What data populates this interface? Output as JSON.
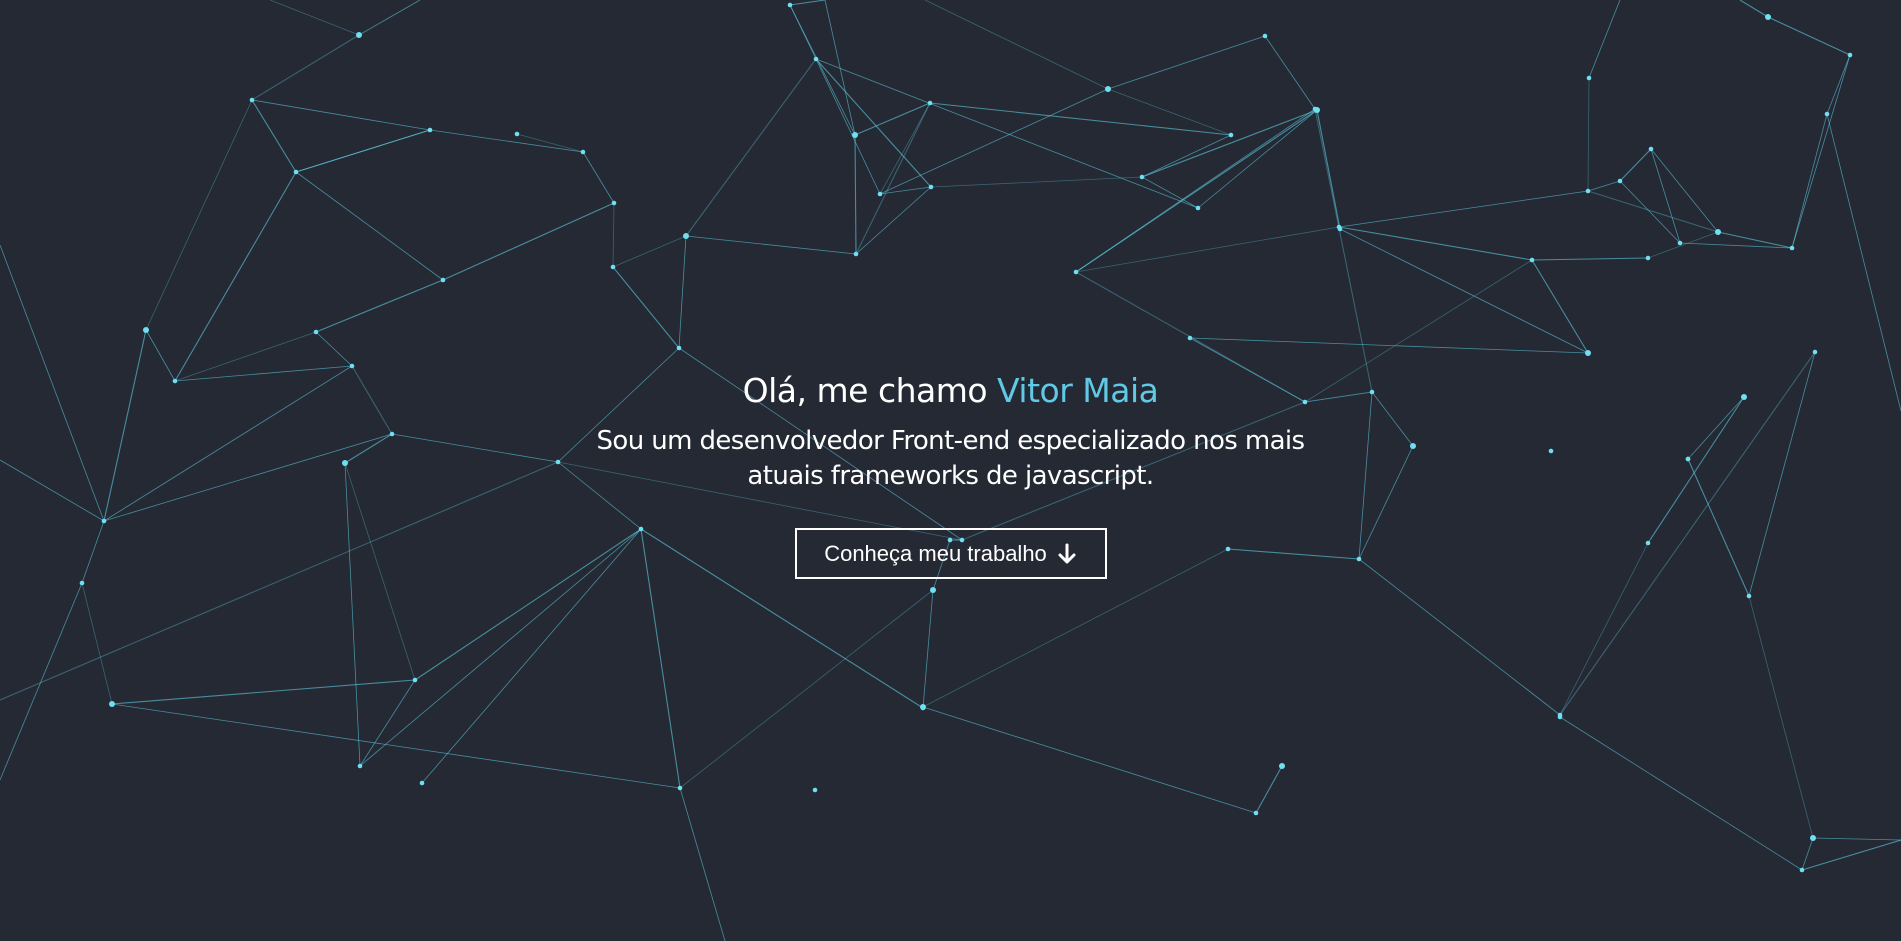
{
  "hero": {
    "greeting_prefix": "Olá, me chamo ",
    "greeting_name": "Vitor Maia",
    "subtitle_line1": "Sou um desenvolvedor Front-end especializado nos mais",
    "subtitle_line2": "atuais frameworks de javascript.",
    "cta_label": "Conheça meu trabalho",
    "cta_icon": "arrow-down-icon"
  },
  "colors": {
    "background": "#252934",
    "accent": "#60c9e6",
    "text": "#ffffff"
  },
  "background_graphic": "particle-network"
}
